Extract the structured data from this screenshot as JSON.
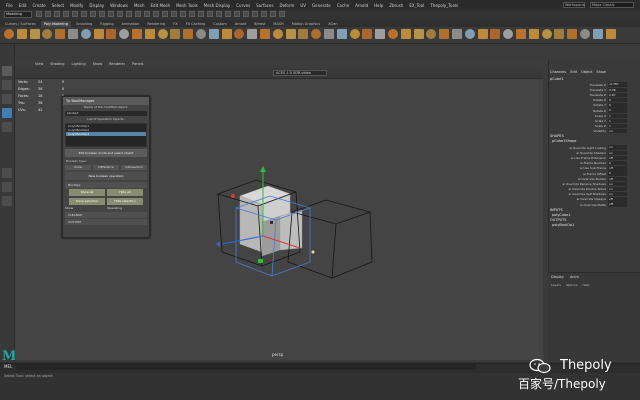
{
  "menubar": {
    "items": [
      "File",
      "Edit",
      "Create",
      "Select",
      "Modify",
      "Display",
      "Windows",
      "Mesh",
      "Edit Mesh",
      "Mesh Tools",
      "Mesh Display",
      "Curves",
      "Surfaces",
      "Deform",
      "UV",
      "Generate",
      "Cache",
      "Arnold",
      "Help",
      "Zbrush",
      "EX_Tool",
      "Thepoly_Tools"
    ],
    "workspace_label": "Workspace:",
    "workspace_value": "Maya Classic"
  },
  "status_line": {
    "mode": "Modeling",
    "symmetry": "No Live Surface",
    "symmetry2": "Symmetry: Off"
  },
  "shelf_tabs": [
    "Curves / Surfaces",
    "Poly Modeling",
    "Sculpting",
    "Rigging",
    "Animation",
    "Rendering",
    "FX",
    "FX Caching",
    "Custom",
    "Arnold",
    "Bifrost",
    "MASH",
    "Motion Graphics",
    "XGen"
  ],
  "shelf_active_tab": "Poly Modeling",
  "viewport": {
    "menu": [
      "View",
      "Shading",
      "Lighting",
      "Show",
      "Renderer",
      "Panels"
    ],
    "camera_field": "ACES 1.0 SDR-video",
    "label": "persp",
    "hud": [
      {
        "k": "Verts:",
        "v": "24",
        "v2": "0"
      },
      {
        "k": "Edges:",
        "v": "36",
        "v2": "0"
      },
      {
        "k": "Faces:",
        "v": "18",
        "v2": "0"
      },
      {
        "k": "Tris:",
        "v": "36",
        "v2": "0"
      },
      {
        "k": "UVs:",
        "v": "42",
        "v2": "0"
      }
    ]
  },
  "plugin": {
    "title": "Tp BoolManager",
    "subtitle": "Name of the modified object:",
    "name_value": "pCube1",
    "list_header": "List of operation objects:",
    "list_items": [
      "polyCBoolOp1",
      "polyCBoolOp2",
      "polyCBoolOp3"
    ],
    "selected_index": 2,
    "exit_button": "Exit boolean mode and select object",
    "boolean_type": "Boolean type:",
    "boolean_options": [
      "Union",
      "Difference",
      "Intersection"
    ],
    "new_button": "New boolean operation",
    "section_boolops": "BoolOps",
    "grid_buttons": [
      "Show all",
      "Hide all",
      "Show selection",
      "Hide selection"
    ],
    "check_label": "Show",
    "check_label2": "Operating",
    "sections": [
      "CLEANUP",
      "CUSTOM"
    ]
  },
  "channel_box": {
    "tabs": [
      "Channels",
      "Edit",
      "Object",
      "Show"
    ],
    "object_name": "pCube1",
    "attrs": [
      {
        "n": "Translate X",
        "v": "-0.787"
      },
      {
        "n": "Translate Y",
        "v": "0.06"
      },
      {
        "n": "Translate Z",
        "v": "0.87"
      },
      {
        "n": "Rotate X",
        "v": "0"
      },
      {
        "n": "Rotate Y",
        "v": "0"
      },
      {
        "n": "Rotate Z",
        "v": "0"
      },
      {
        "n": "Scale X",
        "v": "1"
      },
      {
        "n": "Scale Y",
        "v": "1"
      },
      {
        "n": "Scale Z",
        "v": "1"
      },
      {
        "n": "Visibility",
        "v": "on"
      }
    ],
    "shapes_label": "SHAPES",
    "shape_name": "pCube1Shape",
    "shape_attrs": [
      {
        "n": "ai Override Light Linking",
        "v": "on"
      },
      {
        "n": "ai Override Shaders",
        "v": "on"
      },
      {
        "n": "ai Use Frame Extension",
        "v": "off"
      },
      {
        "n": "ai Frame Number",
        "v": "0"
      },
      {
        "n": "ai Use Sub Frame",
        "v": "off"
      },
      {
        "n": "ai Frame Offset",
        "v": "0"
      },
      {
        "n": "ai Override Shader",
        "v": "off"
      },
      {
        "n": "ai Override Receive Shadows",
        "v": "on"
      },
      {
        "n": "ai Override Double Sided",
        "v": "on"
      },
      {
        "n": "ai Override Self Shadows",
        "v": "on"
      },
      {
        "n": "ai Override Opaque",
        "v": "off"
      },
      {
        "n": "ai Override Matte",
        "v": "off"
      }
    ],
    "inputs_label": "INPUTS",
    "input_name": "polyCube1",
    "outputs_label": "OUTPUTS",
    "output_name": "polyBoolOp1"
  },
  "layer_editor": {
    "tabs": [
      "Display",
      "Anim"
    ],
    "menu": [
      "Layers",
      "Options",
      "Help"
    ]
  },
  "command_line": {
    "mel_label": "MEL",
    "help": [
      "Select Tool: select an object"
    ]
  },
  "watermark": {
    "line1": "Thepoly",
    "line2": "百家号/Thepoly"
  }
}
